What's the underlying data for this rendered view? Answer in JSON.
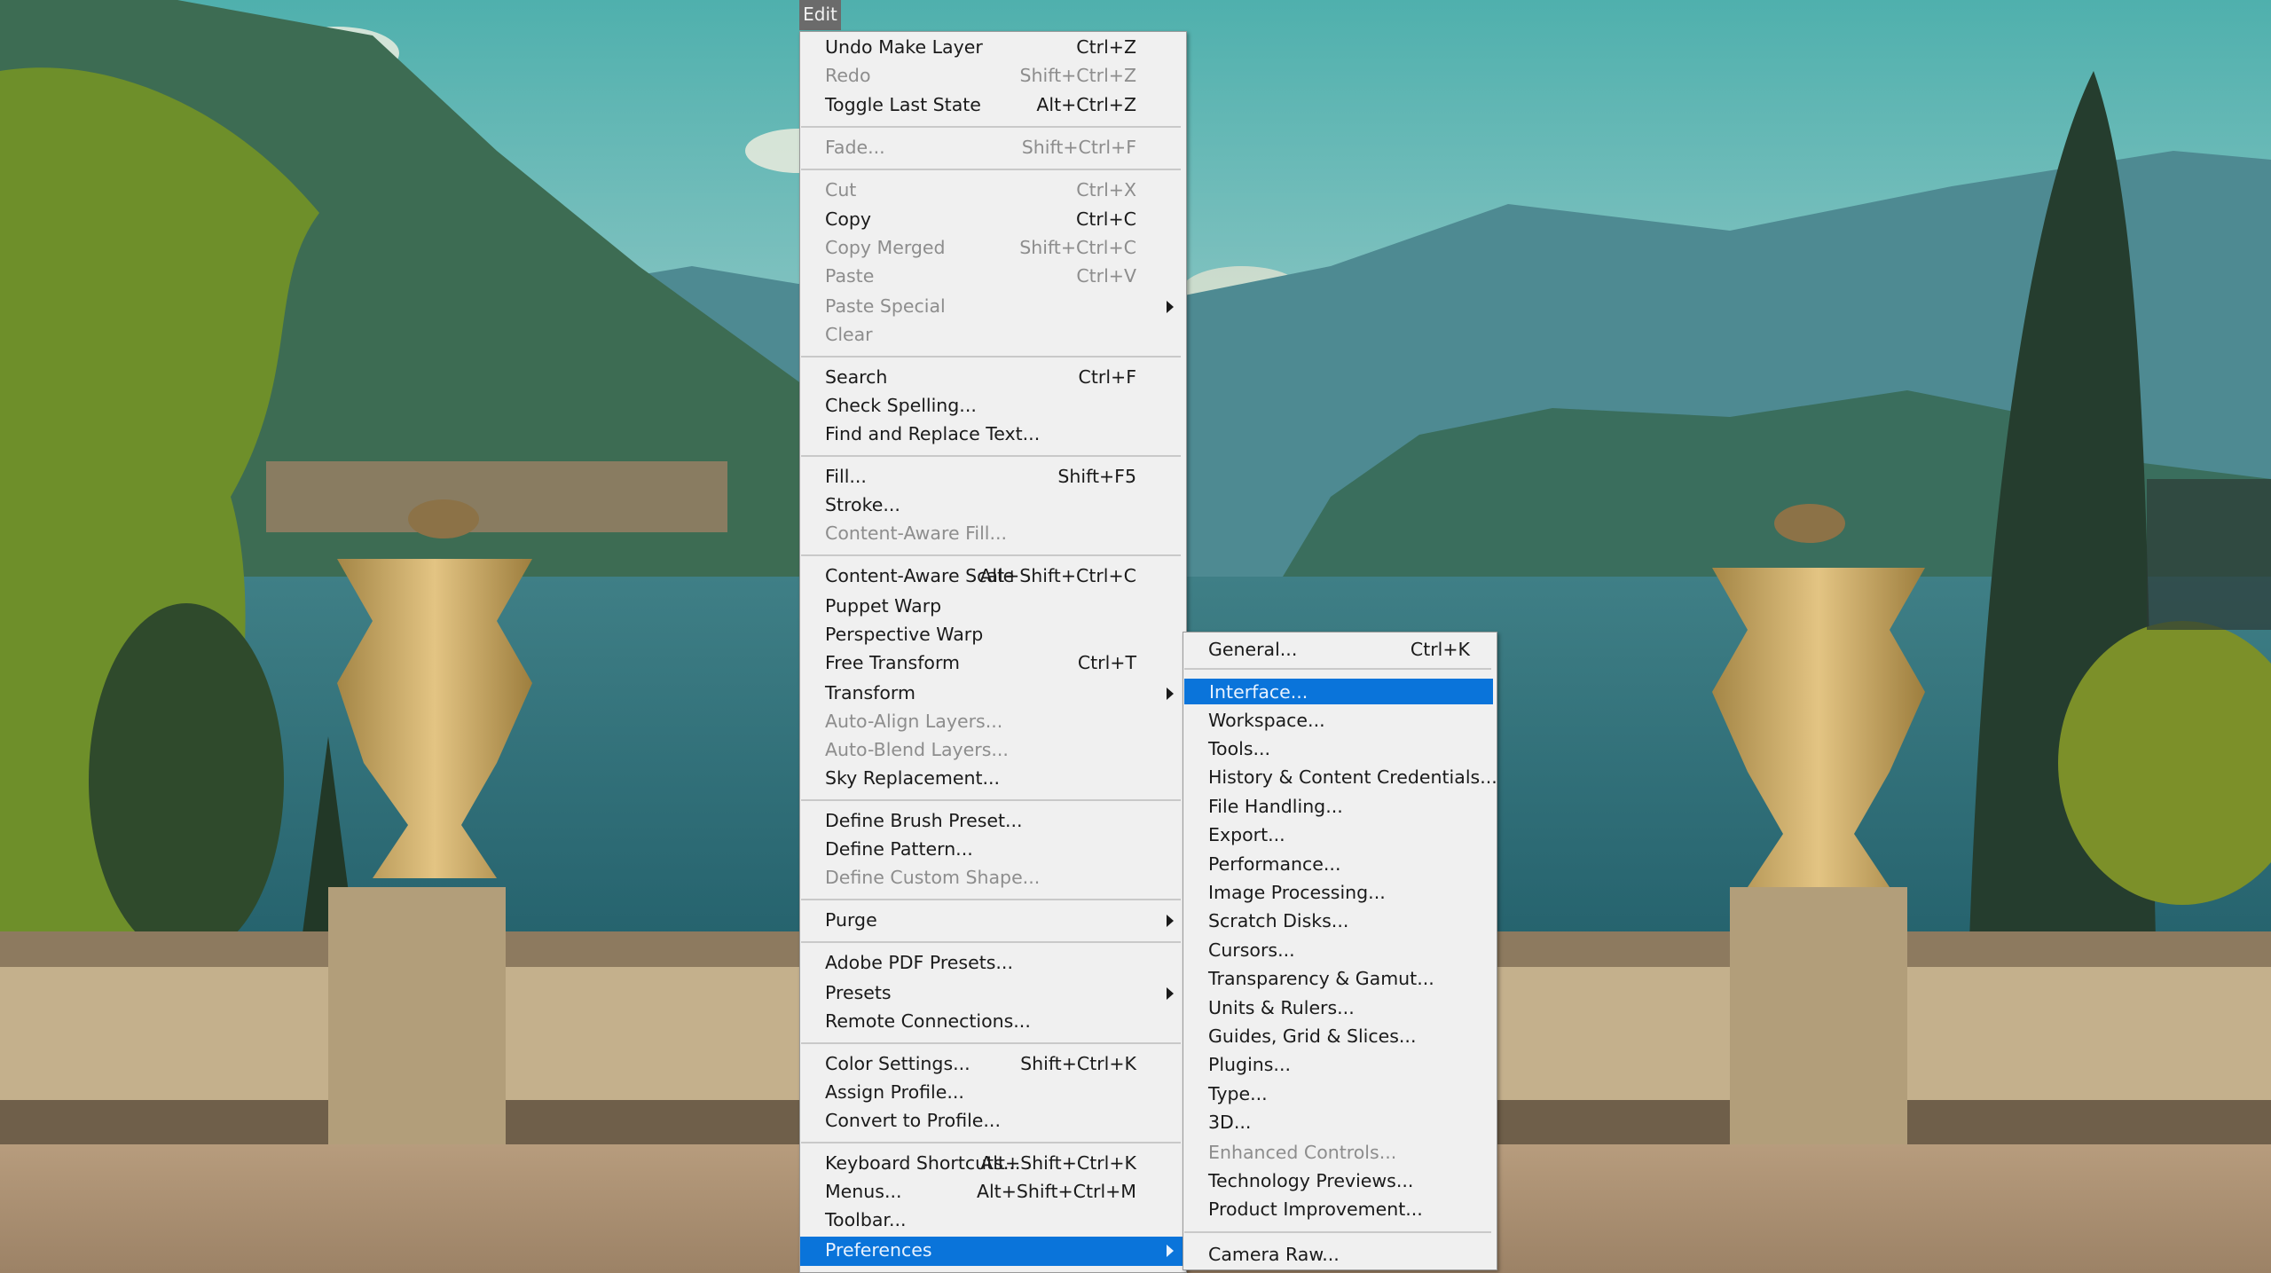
{
  "menubar": {
    "edit_label": "Edit"
  },
  "colors": {
    "highlight": "#0a74da",
    "menu_bg": "#f0f0f0",
    "disabled_text": "#8d8d8d"
  },
  "edit_menu": {
    "items": [
      {
        "label": "Undo Make Layer",
        "shortcut": "Ctrl+Z",
        "enabled": true
      },
      {
        "label": "Redo",
        "shortcut": "Shift+Ctrl+Z",
        "enabled": false
      },
      {
        "label": "Toggle Last State",
        "shortcut": "Alt+Ctrl+Z",
        "enabled": true
      },
      {
        "label": "Fade...",
        "shortcut": "Shift+Ctrl+F",
        "enabled": false
      },
      {
        "label": "Cut",
        "shortcut": "Ctrl+X",
        "enabled": false
      },
      {
        "label": "Copy",
        "shortcut": "Ctrl+C",
        "enabled": true
      },
      {
        "label": "Copy Merged",
        "shortcut": "Shift+Ctrl+C",
        "enabled": false
      },
      {
        "label": "Paste",
        "shortcut": "Ctrl+V",
        "enabled": false
      },
      {
        "label": "Paste Special",
        "shortcut": "",
        "enabled": false,
        "submenu": true
      },
      {
        "label": "Clear",
        "shortcut": "",
        "enabled": false
      },
      {
        "label": "Search",
        "shortcut": "Ctrl+F",
        "enabled": true
      },
      {
        "label": "Check Spelling...",
        "shortcut": "",
        "enabled": true
      },
      {
        "label": "Find and Replace Text...",
        "shortcut": "",
        "enabled": true
      },
      {
        "label": "Fill...",
        "shortcut": "Shift+F5",
        "enabled": true
      },
      {
        "label": "Stroke...",
        "shortcut": "",
        "enabled": true
      },
      {
        "label": "Content-Aware Fill...",
        "shortcut": "",
        "enabled": false
      },
      {
        "label": "Content-Aware Scale",
        "shortcut": "Alt+Shift+Ctrl+C",
        "enabled": true
      },
      {
        "label": "Puppet Warp",
        "shortcut": "",
        "enabled": true
      },
      {
        "label": "Perspective Warp",
        "shortcut": "",
        "enabled": true
      },
      {
        "label": "Free Transform",
        "shortcut": "Ctrl+T",
        "enabled": true
      },
      {
        "label": "Transform",
        "shortcut": "",
        "enabled": true,
        "submenu": true
      },
      {
        "label": "Auto-Align Layers...",
        "shortcut": "",
        "enabled": false
      },
      {
        "label": "Auto-Blend Layers...",
        "shortcut": "",
        "enabled": false
      },
      {
        "label": "Sky Replacement...",
        "shortcut": "",
        "enabled": true
      },
      {
        "label": "Define Brush Preset...",
        "shortcut": "",
        "enabled": true
      },
      {
        "label": "Define Pattern...",
        "shortcut": "",
        "enabled": true
      },
      {
        "label": "Define Custom Shape...",
        "shortcut": "",
        "enabled": false
      },
      {
        "label": "Purge",
        "shortcut": "",
        "enabled": true,
        "submenu": true
      },
      {
        "label": "Adobe PDF Presets...",
        "shortcut": "",
        "enabled": true
      },
      {
        "label": "Presets",
        "shortcut": "",
        "enabled": true,
        "submenu": true
      },
      {
        "label": "Remote Connections...",
        "shortcut": "",
        "enabled": true
      },
      {
        "label": "Color Settings...",
        "shortcut": "Shift+Ctrl+K",
        "enabled": true
      },
      {
        "label": "Assign Profile...",
        "shortcut": "",
        "enabled": true
      },
      {
        "label": "Convert to Profile...",
        "shortcut": "",
        "enabled": true
      },
      {
        "label": "Keyboard Shortcuts...",
        "shortcut": "Alt+Shift+Ctrl+K",
        "enabled": true
      },
      {
        "label": "Menus...",
        "shortcut": "Alt+Shift+Ctrl+M",
        "enabled": true
      },
      {
        "label": "Toolbar...",
        "shortcut": "",
        "enabled": true
      },
      {
        "label": "Preferences",
        "shortcut": "",
        "enabled": true,
        "submenu": true,
        "highlighted": true
      }
    ]
  },
  "preferences_menu": {
    "items": [
      {
        "label": "General...",
        "shortcut": "Ctrl+K",
        "enabled": true
      },
      {
        "label": "Interface...",
        "shortcut": "",
        "enabled": true,
        "highlighted": true
      },
      {
        "label": "Workspace...",
        "shortcut": "",
        "enabled": true
      },
      {
        "label": "Tools...",
        "shortcut": "",
        "enabled": true
      },
      {
        "label": "History & Content Credentials...",
        "shortcut": "",
        "enabled": true
      },
      {
        "label": "File Handling...",
        "shortcut": "",
        "enabled": true
      },
      {
        "label": "Export...",
        "shortcut": "",
        "enabled": true
      },
      {
        "label": "Performance...",
        "shortcut": "",
        "enabled": true
      },
      {
        "label": "Image Processing...",
        "shortcut": "",
        "enabled": true
      },
      {
        "label": "Scratch Disks...",
        "shortcut": "",
        "enabled": true
      },
      {
        "label": "Cursors...",
        "shortcut": "",
        "enabled": true
      },
      {
        "label": "Transparency & Gamut...",
        "shortcut": "",
        "enabled": true
      },
      {
        "label": "Units & Rulers...",
        "shortcut": "",
        "enabled": true
      },
      {
        "label": "Guides, Grid & Slices...",
        "shortcut": "",
        "enabled": true
      },
      {
        "label": "Plugins...",
        "shortcut": "",
        "enabled": true
      },
      {
        "label": "Type...",
        "shortcut": "",
        "enabled": true
      },
      {
        "label": "3D...",
        "shortcut": "",
        "enabled": true
      },
      {
        "label": "Enhanced Controls...",
        "shortcut": "",
        "enabled": false
      },
      {
        "label": "Technology Previews...",
        "shortcut": "",
        "enabled": true
      },
      {
        "label": "Product Improvement...",
        "shortcut": "",
        "enabled": true
      },
      {
        "label": "Camera Raw...",
        "shortcut": "",
        "enabled": true
      }
    ]
  }
}
